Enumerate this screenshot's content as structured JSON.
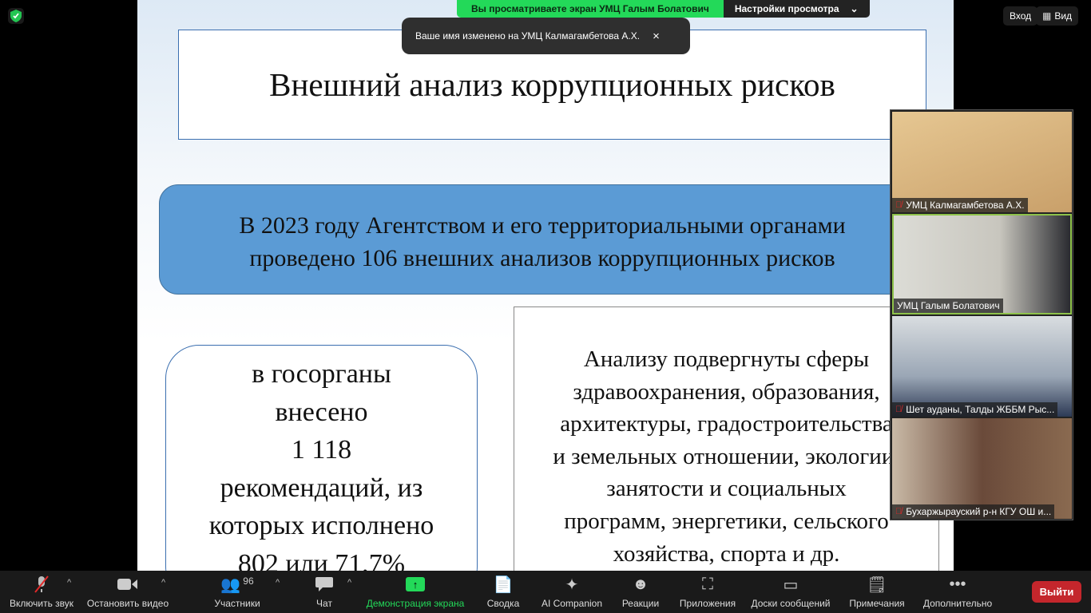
{
  "slide": {
    "title": "Внешний анализ коррупционных рисков",
    "banner_lines": [
      "В 2023 году Агентством и его территориальными органами",
      "проведено 106 внешних анализов коррупционных рисков"
    ],
    "left_lines": [
      "в госорганы",
      "внесено",
      "1 118",
      "рекомендаций, из",
      "которых исполнено",
      "802 или 71,7%"
    ],
    "right_lines": [
      "Анализу подвергнуты сферы",
      "здравоохранения, образования,",
      "архитектуры, градостроительства",
      "и земельных отношении, экологии,",
      "занятости и социальных",
      "программ, энергетики, сельского",
      "хозяйства, спорта и др."
    ]
  },
  "share_banner": {
    "text": "Вы просматриваете экран УМЦ Галым Болатович",
    "view_options": "Настройки просмотра"
  },
  "toast": {
    "text": "Ваше имя изменено на УМЦ Калмагамбетова А.Х.",
    "close": "×"
  },
  "top_right": {
    "enter": "Вход",
    "view": "Вид"
  },
  "participants": [
    {
      "name": "УМЦ Калмагамбетова А.Х.",
      "muted": true,
      "bg": "#d9b47a"
    },
    {
      "name": "УМЦ Галым Болатович",
      "muted": false,
      "bg": "#c9c8c2"
    },
    {
      "name": "Шет ауданы,  Талды ЖББМ Рыс...",
      "muted": true,
      "bg": "#bfc6cc"
    },
    {
      "name": "Бухаржырауский р-н КГУ ОШ и...",
      "muted": true,
      "bg": "#8a6a55"
    }
  ],
  "toolbar": {
    "audio": "Включить звук",
    "video": "Остановить видео",
    "participants": "Участники",
    "participants_count": "96",
    "chat": "Чат",
    "share": "Демонстрация экрана",
    "summary": "Сводка",
    "ai": "AI Companion",
    "reactions": "Реакции",
    "apps": "Приложения",
    "whiteboards": "Доски сообщений",
    "notes": "Примечания",
    "more": "Дополнительно",
    "leave": "Выйти"
  },
  "colors": {
    "share_green": "#23d959",
    "leave_red": "#c4262c",
    "slide_blue": "#5b9bd5"
  }
}
